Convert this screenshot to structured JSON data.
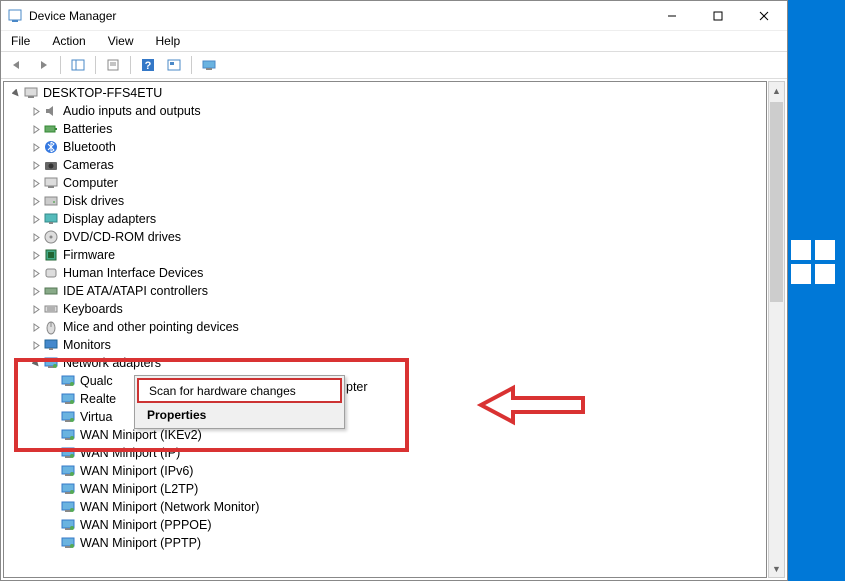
{
  "window": {
    "title": "Device Manager"
  },
  "menus": {
    "file": "File",
    "action": "Action",
    "view": "View",
    "help": "Help"
  },
  "root": "DESKTOP-FFS4ETU",
  "categories": [
    "Audio inputs and outputs",
    "Batteries",
    "Bluetooth",
    "Cameras",
    "Computer",
    "Disk drives",
    "Display adapters",
    "DVD/CD-ROM drives",
    "Firmware",
    "Human Interface Devices",
    "IDE ATA/ATAPI controllers",
    "Keyboards",
    "Mice and other pointing devices",
    "Monitors",
    "Network adapters"
  ],
  "network_children": [
    "Qualc",
    "Realte",
    "Virtua",
    "WAN Miniport (IKEv2)",
    "WAN Miniport (IP)",
    "WAN Miniport (IPv6)",
    "WAN Miniport (L2TP)",
    "WAN Miniport (Network Monitor)",
    "WAN Miniport (PPPOE)",
    "WAN Miniport (PPTP)"
  ],
  "partial_visible": "pter",
  "context_menu": {
    "scan": "Scan for hardware changes",
    "properties": "Properties"
  }
}
